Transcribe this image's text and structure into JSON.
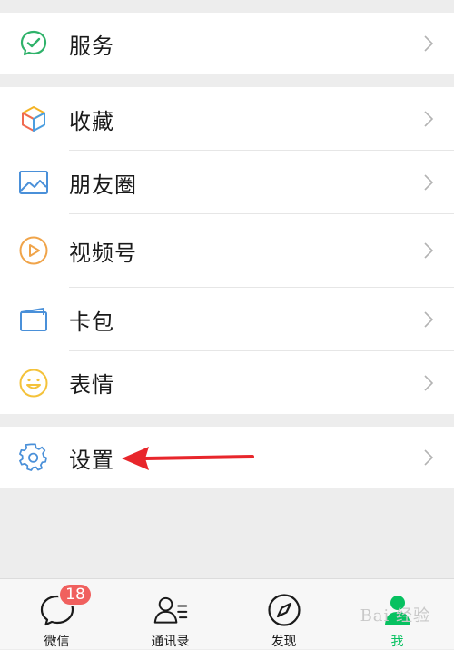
{
  "menu": {
    "group1": [
      {
        "label": "服务",
        "icon": "services-check-icon"
      }
    ],
    "group2": [
      {
        "label": "收藏",
        "icon": "favorites-cube-icon"
      },
      {
        "label": "朋友圈",
        "icon": "moments-picture-icon"
      },
      {
        "label": "视频号",
        "icon": "channels-play-icon"
      },
      {
        "label": "卡包",
        "icon": "card-wallet-icon"
      },
      {
        "label": "表情",
        "icon": "stickers-smile-icon"
      }
    ],
    "group3": [
      {
        "label": "设置",
        "icon": "gear-icon"
      }
    ]
  },
  "tabbar": {
    "tabs": [
      {
        "label": "微信",
        "icon": "chat-bubble-icon",
        "badge": "18"
      },
      {
        "label": "通讯录",
        "icon": "contacts-icon"
      },
      {
        "label": "发现",
        "icon": "compass-icon"
      },
      {
        "label": "我",
        "icon": "me-person-icon",
        "active": true
      }
    ]
  },
  "colors": {
    "active": "#07c160",
    "badge": "#f0605e",
    "arrow": "#e8262b"
  },
  "watermark": "Bai 经验"
}
